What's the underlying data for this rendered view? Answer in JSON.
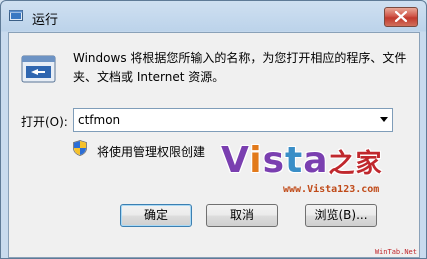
{
  "window": {
    "title": "运行"
  },
  "description": "Windows 将根据您所输入的名称，为您打开相应的程序、文件夹、文档或 Internet 资源。",
  "open": {
    "label": "打开(O):",
    "value": "ctfmon"
  },
  "admin_note": "将使用管理权限创建",
  "watermark": {
    "letters": [
      "V",
      "i",
      "s",
      "t",
      "a"
    ],
    "chinese": "之家",
    "url": "www.Vista123.com",
    "corner": "WinTab.Net"
  },
  "buttons": {
    "ok": "确定",
    "cancel": "取消",
    "browse": "浏览(B)..."
  },
  "colors": {
    "close": "#c13a2d",
    "default_border": "#3c7fb1"
  },
  "icons": [
    "run-app-icon",
    "close-icon",
    "run-program-icon",
    "uac-shield-icon",
    "dropdown-arrow-icon"
  ]
}
